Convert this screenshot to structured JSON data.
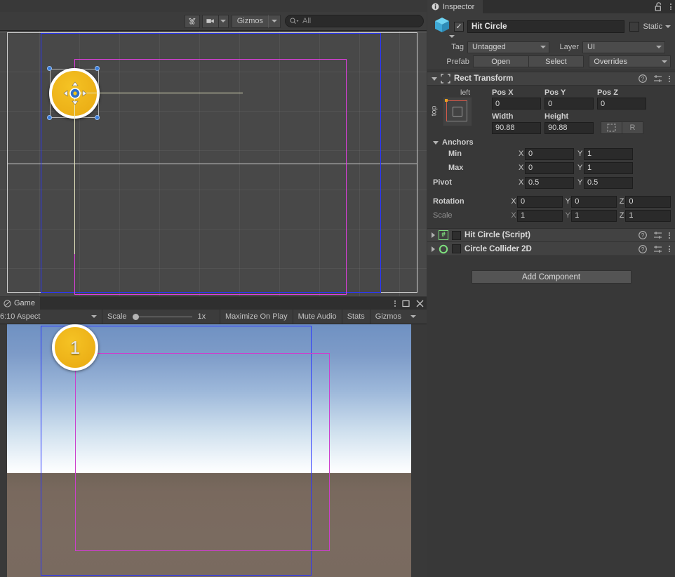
{
  "scene": {
    "toolbar": {
      "tools_icon": "tools-icon",
      "camera_icon": "camera-icon",
      "gizmos_label": "Gizmos",
      "search_icon": "search-icon",
      "search_placeholder": "All",
      "search_value": ""
    },
    "viewport": {
      "object_name": "Hit Circle",
      "gizmo_icon": "move-tool-gizmo"
    }
  },
  "game": {
    "tab_label": "Game",
    "tab_icon": "game-view-icon",
    "window_menu_icon": "kebab-menu-icon",
    "maximize_icon": "maximize-icon",
    "close_icon": "close-icon",
    "toolbar": {
      "aspect": "6:10 Aspect",
      "scale_label": "Scale",
      "scale_value": "1x",
      "scale_slider_pct": 0,
      "maximize_on_play": "Maximize On Play",
      "mute_audio": "Mute Audio",
      "stats": "Stats",
      "gizmos": "Gizmos"
    },
    "circle_number": "1"
  },
  "inspector": {
    "tab_label": "Inspector",
    "tab_icon": "info-icon",
    "lock_icon": "lock-open-icon",
    "menu_icon": "kebab-menu-icon",
    "object": {
      "icon": "cube-prefab-icon",
      "active": true,
      "active_check_glyph": "✓",
      "name": "Hit Circle",
      "static_checked": false,
      "static_label": "Static"
    },
    "tag_row": {
      "tag_label": "Tag",
      "tag_value": "Untagged",
      "layer_label": "Layer",
      "layer_value": "UI"
    },
    "prefab_row": {
      "prefab_label": "Prefab",
      "open_label": "Open",
      "select_label": "Select",
      "overrides_label": "Overrides"
    },
    "rect_transform": {
      "title": "Rect Transform",
      "icon": "rect-transform-icon",
      "help_icon": "help-icon",
      "preset_icon": "preset-sliders-icon",
      "menu_icon": "kebab-menu-icon",
      "anchor_preset": {
        "top_label": "left",
        "side_label": "top"
      },
      "pos_headers": [
        "Pos X",
        "Pos Y",
        "Pos Z"
      ],
      "pos_values": [
        "0",
        "0",
        "0"
      ],
      "size_headers": [
        "Width",
        "Height"
      ],
      "size_values": [
        "90.88",
        "90.88"
      ],
      "blueprint_icon": "blueprint-mode-icon",
      "raw_label": "R",
      "anchors_label": "Anchors",
      "min_label": "Min",
      "min": {
        "x": "0",
        "y": "1"
      },
      "max_label": "Max",
      "max": {
        "x": "0",
        "y": "1"
      },
      "pivot_label": "Pivot",
      "pivot": {
        "x": "0.5",
        "y": "0.5"
      },
      "rotation_label": "Rotation",
      "rotation": {
        "x": "0",
        "y": "0",
        "z": "0"
      },
      "scale_label": "Scale",
      "scale": {
        "x": "1",
        "y": "1",
        "z": "1"
      },
      "axis_x": "X",
      "axis_y": "Y",
      "axis_z": "Z"
    },
    "components": [
      {
        "title": "Hit Circle (Script)",
        "icon": "script-icon",
        "enabled": false,
        "help_icon": "help-icon",
        "preset_icon": "preset-sliders-icon",
        "menu_icon": "kebab-menu-icon"
      },
      {
        "title": "Circle Collider 2D",
        "icon": "circle-collider-2d-icon",
        "enabled": false,
        "help_icon": "help-icon",
        "preset_icon": "preset-sliders-icon",
        "menu_icon": "kebab-menu-icon"
      }
    ],
    "add_component_label": "Add Component"
  },
  "colors": {
    "canvas_rect": "#2a36ff",
    "gizmo_rect": "#cc3fcc",
    "hit_circle_fill": "#eeb41a",
    "handle": "#3a7ddc",
    "script_icon": "#7ee07e",
    "panel_bg": "#383838"
  }
}
